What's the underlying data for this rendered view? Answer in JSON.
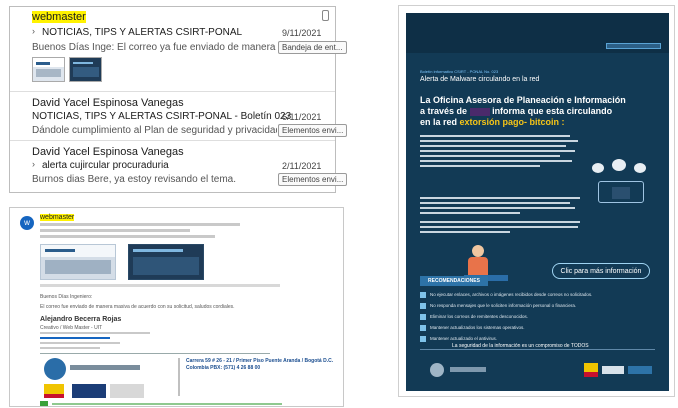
{
  "mail_list": {
    "items": [
      {
        "sender": "webmaster",
        "subject": "NOTICIAS, TIPS Y ALERTAS CSIRT-PONAL",
        "date": "9/11/2021",
        "preview": "Buenos Días Inge: El correo ya fue enviado de manera masi...",
        "category": "Bandeja de ent..."
      },
      {
        "sender": "David Yacel Espinosa Vanegas",
        "subject": "NOTICIAS, TIPS Y ALERTAS CSIRT-PONAL - Boletín 023",
        "date": "6/11/2021",
        "preview": "Dándole cumplimiento al Plan de seguridad y privacidad de...",
        "category": "Elementos envi..."
      },
      {
        "sender": "David Yacel Espinosa Vanegas",
        "subject": "alerta cujircular procuraduria",
        "date": "2/11/2021",
        "preview": "Burnos dias Bere, ya estoy revisando el tema.",
        "category": "Elementos envi..."
      }
    ]
  },
  "mail_view": {
    "avatar_letter": "w",
    "sender": "webmaster",
    "greeting": "Buenos Días Ingeniero:",
    "body": "El correo fue enviado de manera masiva de acuerdo con su solicitud, saludos cordiales.",
    "signature_name": "Alejandro Becerra Rojas",
    "signature_role": "Creativo / Web Master - UIT",
    "address": "Carrera 59 # 26 - 21 / Primer Piso Puente Aranda / Bogotá D.C. Colombia PBX: (571) 4 26 88 00"
  },
  "poster": {
    "header": "Boletín informativo CSIRT - PONAL No. 023",
    "title": "Alerta de Malware circulando en la red",
    "headline_1": "La Oficina Asesora de Planeación e Información",
    "headline_2": "a través de",
    "headline_3": "informa que esta circulando",
    "headline_4": "en la red",
    "headline_accent": "extorsión pago- bitcoin :",
    "cta": "Clic para más información",
    "recommendations_title": "RECOMENDACIONES",
    "recommendations": [
      "No ejecutar enlaces, archivos o imágenes recibidos desde correos no solicitados.",
      "No responda mensajes que le soliciten información personal o financiera.",
      "Eliminar los correos de remitentes desconocidos.",
      "Mantener actualizados los sistemas operativos.",
      "Mantener actualizado el antivirus."
    ],
    "footer_slogan": "La seguridad de la información es un compromiso de TODOS",
    "colors": {
      "background": "#123a55",
      "accent": "#f5c518",
      "cyan": "#22c4e8"
    }
  }
}
